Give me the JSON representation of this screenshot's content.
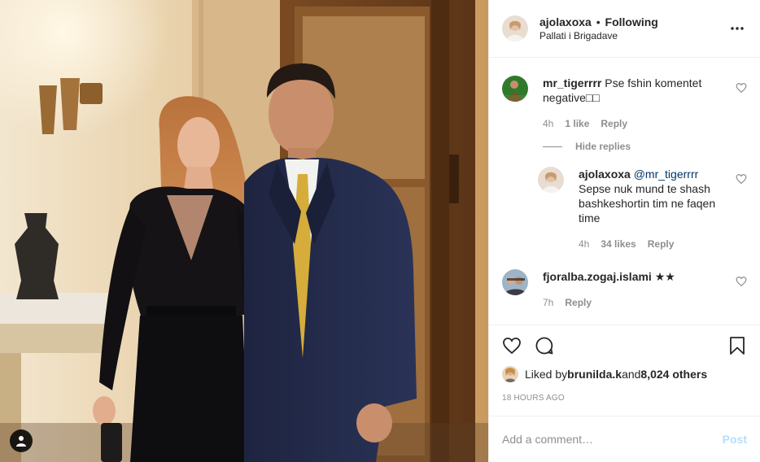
{
  "post": {
    "owner": "ajolaxoxa",
    "separator": "•",
    "follow_status": "Following",
    "location": "Pallati i Brigadave"
  },
  "icons": {
    "more": "more-horizontal-icon",
    "heart": "heart-icon",
    "comment": "comment-icon",
    "save": "bookmark-icon",
    "user_tags": "user-tag-icon"
  },
  "comments": [
    {
      "username": "mr_tigerrrr",
      "text": "Pse fshin komentet negative□□",
      "time": "4h",
      "likes": "1 like",
      "reply_label": "Reply"
    },
    {
      "username": "fjoralba.zogaj.islami",
      "text": "★★",
      "time": "7h",
      "reply_label": "Reply"
    }
  ],
  "hide_replies_label": "Hide replies",
  "reply": {
    "username": "ajolaxoxa",
    "mention": "@mr_tigerrrr",
    "text": " Sepse nuk mund te shash bashkeshortin tim ne faqen time",
    "time": "4h",
    "likes": "34 likes",
    "reply_label": "Reply"
  },
  "liked": {
    "prefix": "Liked by ",
    "user": "brunilda.k",
    "middle": " and ",
    "others": "8,024 others"
  },
  "timestamp": "18 HOURS AGO",
  "add_comment": {
    "placeholder": "Add a comment…",
    "post_label": "Post"
  },
  "colors": {
    "text": "#262626",
    "muted": "#8e8e8e",
    "link": "#003569",
    "post_disabled": "#b2dffc",
    "border": "#efefef"
  }
}
